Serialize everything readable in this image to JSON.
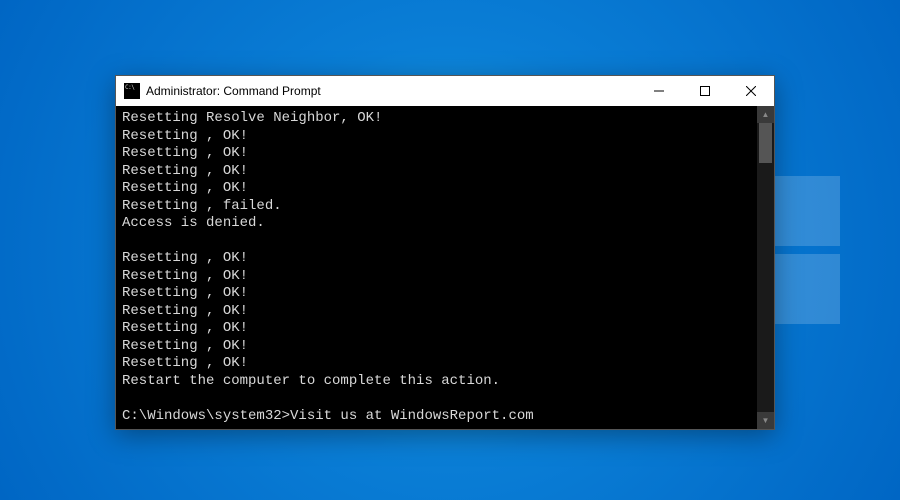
{
  "desktop": {
    "background": "windows-10-default"
  },
  "window": {
    "title": "Administrator: Command Prompt",
    "controls": {
      "minimize": "Minimize",
      "maximize": "Maximize",
      "close": "Close"
    }
  },
  "terminal": {
    "lines": [
      "Resetting Resolve Neighbor, OK!",
      "Resetting , OK!",
      "Resetting , OK!",
      "Resetting , OK!",
      "Resetting , OK!",
      "Resetting , failed.",
      "Access is denied.",
      "",
      "Resetting , OK!",
      "Resetting , OK!",
      "Resetting , OK!",
      "Resetting , OK!",
      "Resetting , OK!",
      "Resetting , OK!",
      "Resetting , OK!",
      "Restart the computer to complete this action.",
      ""
    ],
    "prompt": "C:\\Windows\\system32>",
    "input": "Visit us at WindowsReport.com"
  }
}
